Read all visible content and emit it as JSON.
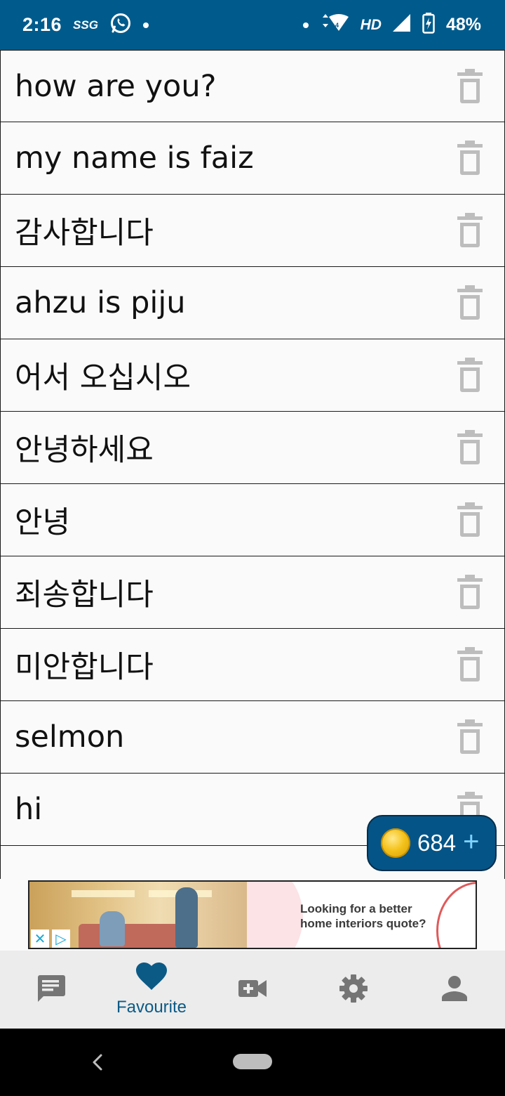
{
  "status_bar": {
    "time": "2:16",
    "carrier_badge": "SSG",
    "network_label": "HD",
    "battery_percent": "48%",
    "icons": [
      "whatsapp-icon",
      "wifi-icon",
      "signal-icon",
      "battery-icon"
    ]
  },
  "favourites": {
    "items": [
      {
        "text": "how are you?"
      },
      {
        "text": "my name is faiz"
      },
      {
        "text": "감사합니다"
      },
      {
        "text": "ahzu is piju"
      },
      {
        "text": "어서 오십시오"
      },
      {
        "text": "안녕하세요"
      },
      {
        "text": "안녕"
      },
      {
        "text": "죄송합니다"
      },
      {
        "text": "미안합니다"
      },
      {
        "text": "selmon"
      },
      {
        "text": "hi"
      }
    ],
    "delete_icon": "trash-icon"
  },
  "coins": {
    "count": "684",
    "plus": "+"
  },
  "ad": {
    "headline_line1": "Looking for a better",
    "headline_line2": "home interiors quote?",
    "close_glyph": "✕",
    "adchoices_glyph": "▷"
  },
  "bottom_nav": {
    "items": [
      {
        "icon": "chat-icon",
        "label": ""
      },
      {
        "icon": "heart-icon",
        "label": "Favourite",
        "active": true
      },
      {
        "icon": "video-add-icon",
        "label": ""
      },
      {
        "icon": "gear-icon",
        "label": ""
      },
      {
        "icon": "person-icon",
        "label": ""
      }
    ]
  },
  "colors": {
    "primary": "#005b8c",
    "nav_active": "#0b5a86",
    "nav_inactive": "#757575",
    "trash": "#bdbdbd"
  }
}
